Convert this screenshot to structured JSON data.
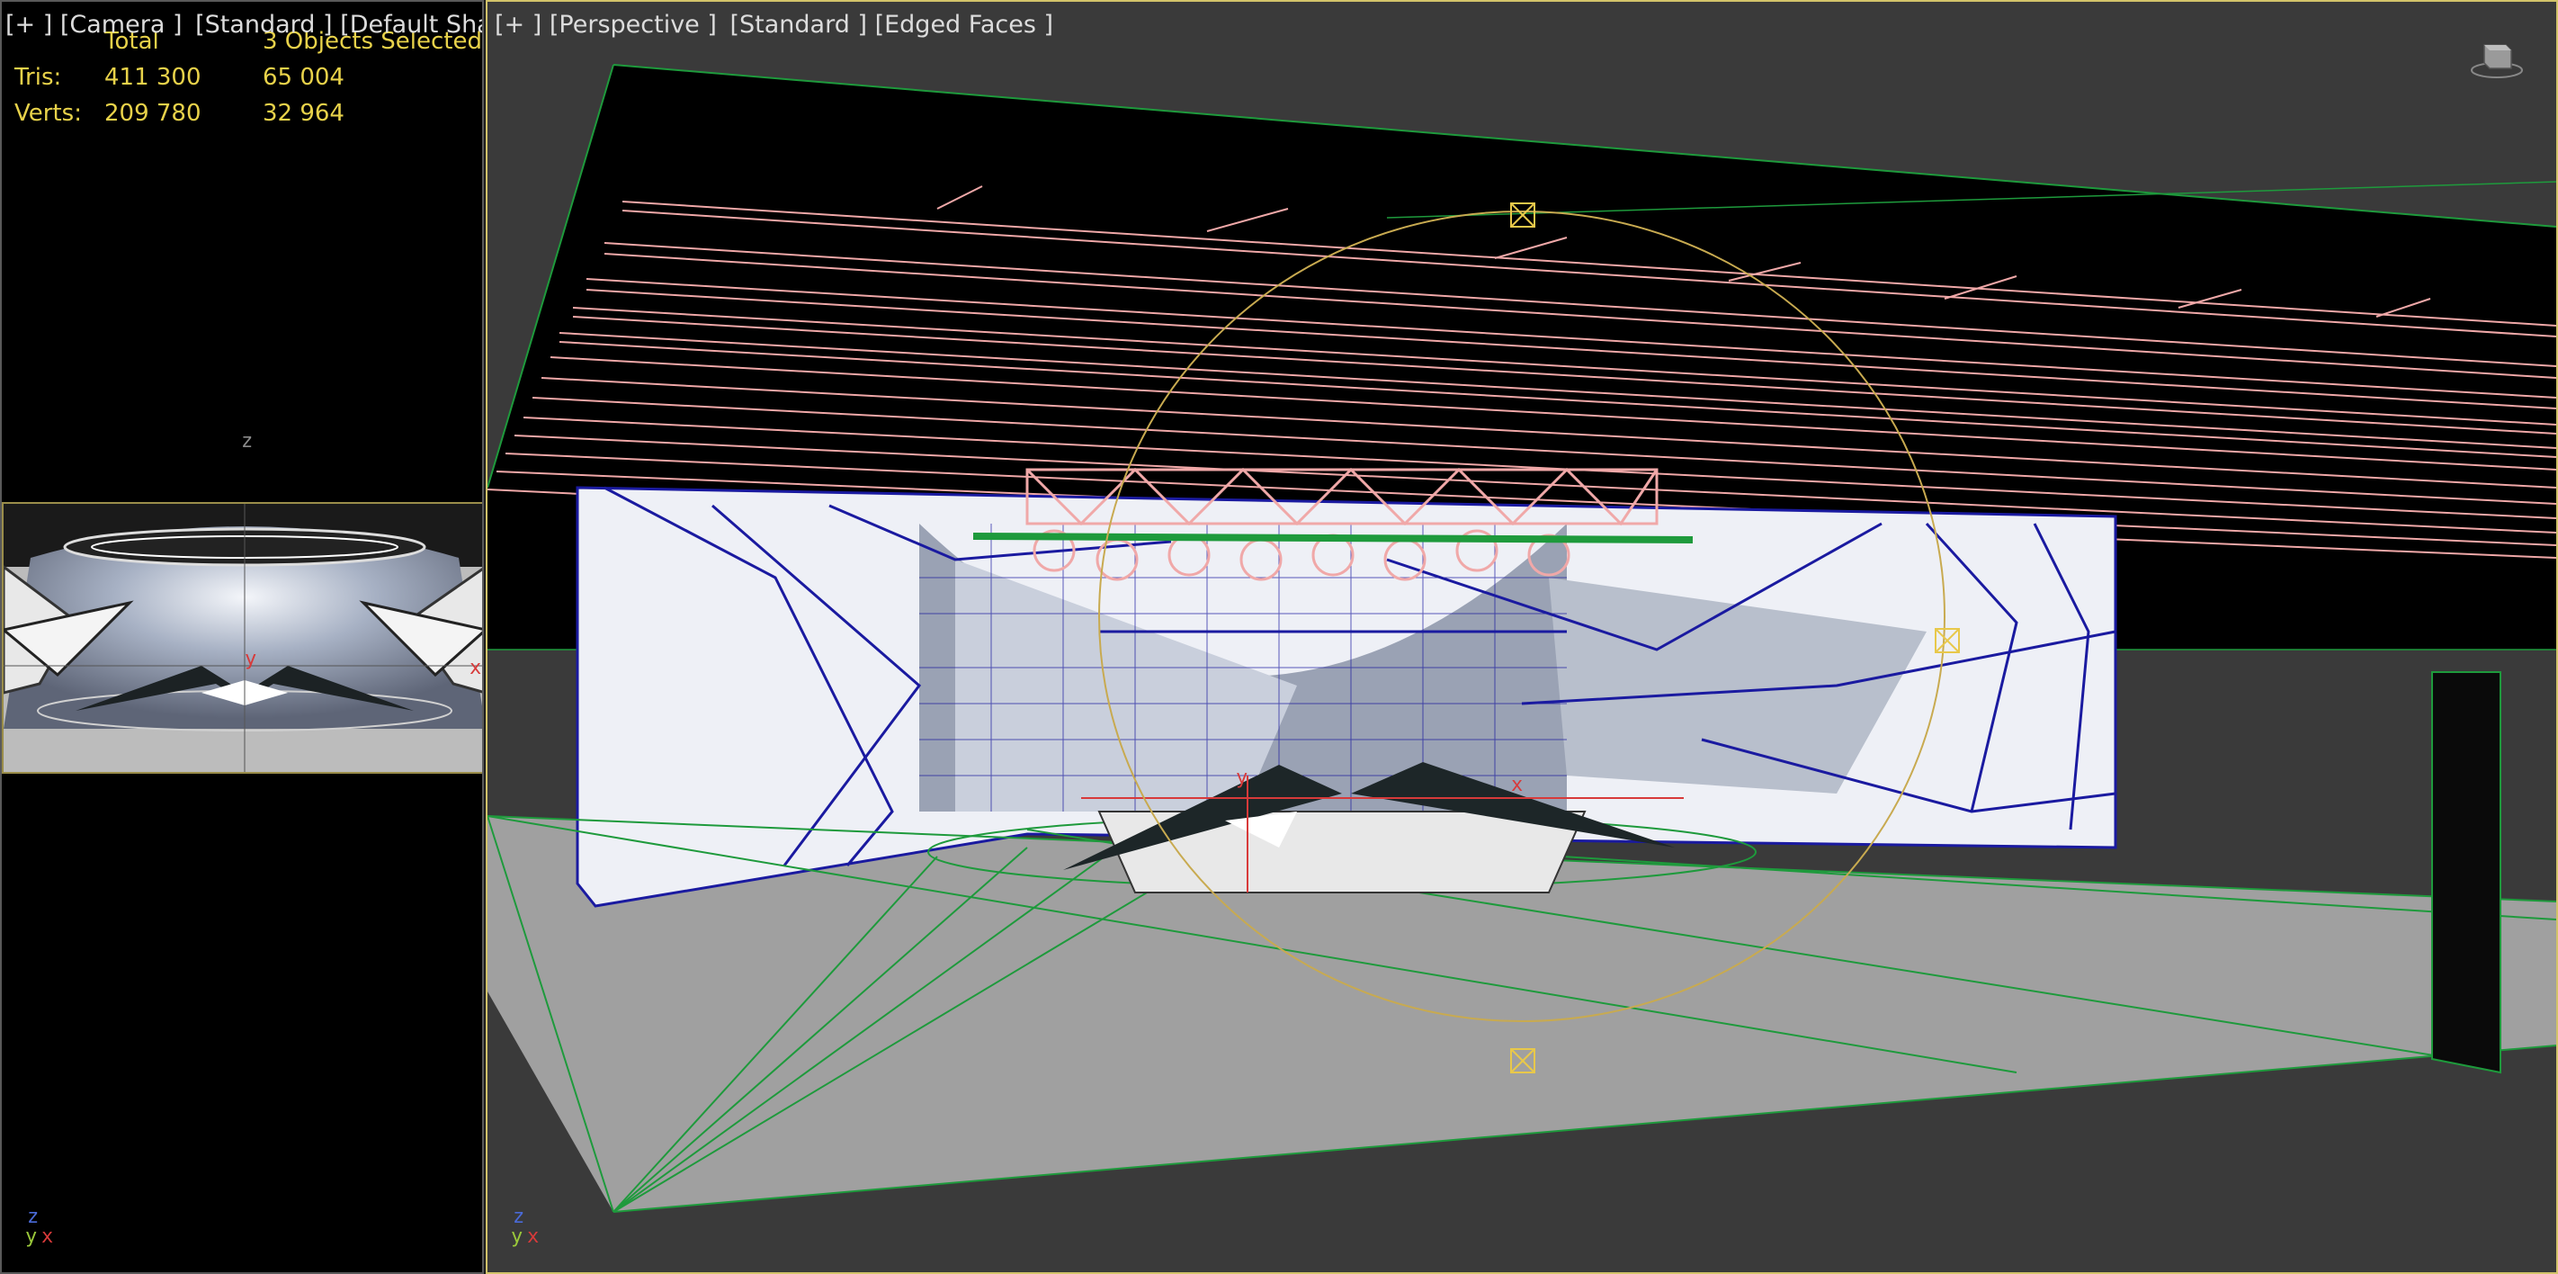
{
  "left_viewport": {
    "label_plus": "[+ ]",
    "label_view": "[Camera ]",
    "label_shading": "[Standard ]",
    "label_mode": "[Default Shadin",
    "stats": {
      "header_total": "Total",
      "header_selected": "3 Objects Selected",
      "tris_label": "Tris:",
      "tris_total": "411 300",
      "tris_selected": "65 004",
      "verts_label": "Verts:",
      "verts_total": "209 780",
      "verts_selected": "32 964"
    },
    "axis_z": "z",
    "gizmo": {
      "z": "z",
      "y": "y",
      "x": "x"
    },
    "thumb_axis_y": "y",
    "thumb_axis_x": "x"
  },
  "right_viewport": {
    "label_plus": "[+ ]",
    "label_view": "[Perspective ]",
    "label_shading": "[Standard ]",
    "label_mode": "[Edged Faces ]",
    "scene_axis_y": "y",
    "scene_axis_x": "x",
    "gizmo": {
      "z": "z",
      "y": "y",
      "x": "x"
    },
    "viewcube": "viewcube-icon"
  },
  "colors": {
    "active_border": "#d2c36a",
    "stats_text": "#e8d24a",
    "truss_wire": "#f0a8a8",
    "stage_wire": "#1a1aa0",
    "floor_wire": "#1e9a3c",
    "light_circle": "#c8aa50",
    "axis_x": "#d83a3a",
    "axis_y": "#9ac83a",
    "axis_z": "#4a6ad8"
  }
}
